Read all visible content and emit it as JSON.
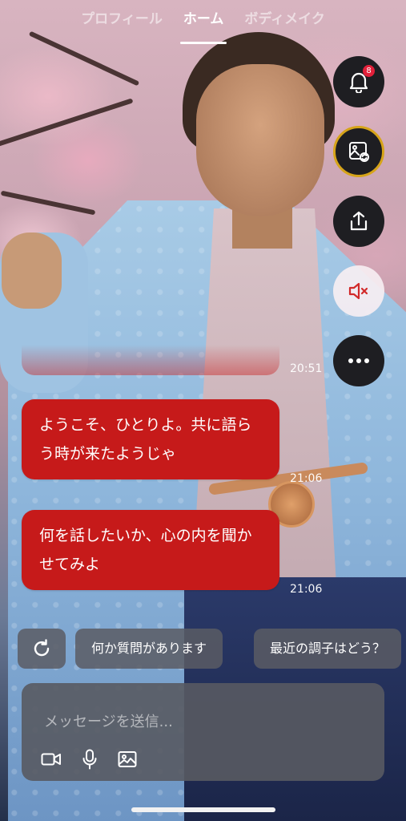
{
  "tabs": [
    {
      "label": "プロフィール",
      "active": false
    },
    {
      "label": "ホーム",
      "active": true
    },
    {
      "label": "ボディメイク",
      "active": false
    }
  ],
  "notifications": {
    "count": "8",
    "icon": "bell-icon"
  },
  "rail_icons": [
    "bell-icon",
    "image-switch-icon",
    "share-icon",
    "muted-speaker-icon",
    "more-icon"
  ],
  "chat": {
    "previous_time": "20:51",
    "messages": [
      {
        "text": "ようこそ、ひとりよ。共に語らう時が来たようじゃ",
        "time": "21:06"
      },
      {
        "text": "何を話したいか、心の内を聞かせてみよ",
        "time": "21:06"
      }
    ]
  },
  "suggestions": [
    "何か質問があります",
    "最近の調子はどう？"
  ],
  "composer": {
    "placeholder": "メッセージを送信...",
    "value": ""
  },
  "colors": {
    "bubble": "#c61a1a",
    "accent_gold": "#d6a419",
    "badge": "#e2203a",
    "mute": "#d12a2a"
  }
}
